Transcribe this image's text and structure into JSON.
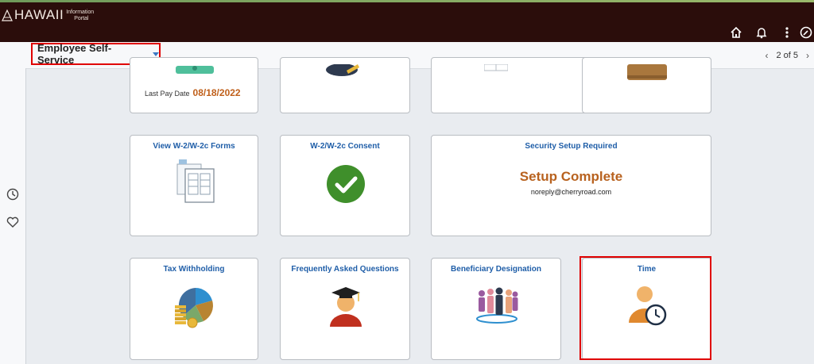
{
  "header": {
    "logo_text": "HAWAII",
    "logo_sub_line1": "Information",
    "logo_sub_line2": "Portal",
    "icons": [
      "home-icon",
      "bell-icon",
      "more-vert-icon",
      "navbar-compass-icon"
    ]
  },
  "subbar": {
    "title": "Employee Self-Service",
    "pager": "2 of 5"
  },
  "tiles": {
    "paycheck": {
      "label": "Last Pay Date",
      "value": "08/18/2022"
    },
    "w2_forms": {
      "title": "View W-2/W-2c Forms"
    },
    "w2_consent": {
      "title": "W-2/W-2c Consent"
    },
    "security": {
      "title": "Security Setup Required",
      "status": "Setup Complete",
      "email": "noreply@cherryroad.com"
    },
    "tax": {
      "title": "Tax Withholding"
    },
    "faq": {
      "title": "Frequently Asked Questions"
    },
    "beneficiary": {
      "title": "Beneficiary Designation"
    },
    "time": {
      "title": "Time"
    }
  },
  "colors": {
    "header_bg": "#2b0d0b",
    "link_blue": "#1f5ea8",
    "accent_orange": "#b8621f",
    "highlight_red": "#e00000",
    "check_green": "#3f8f2b"
  }
}
